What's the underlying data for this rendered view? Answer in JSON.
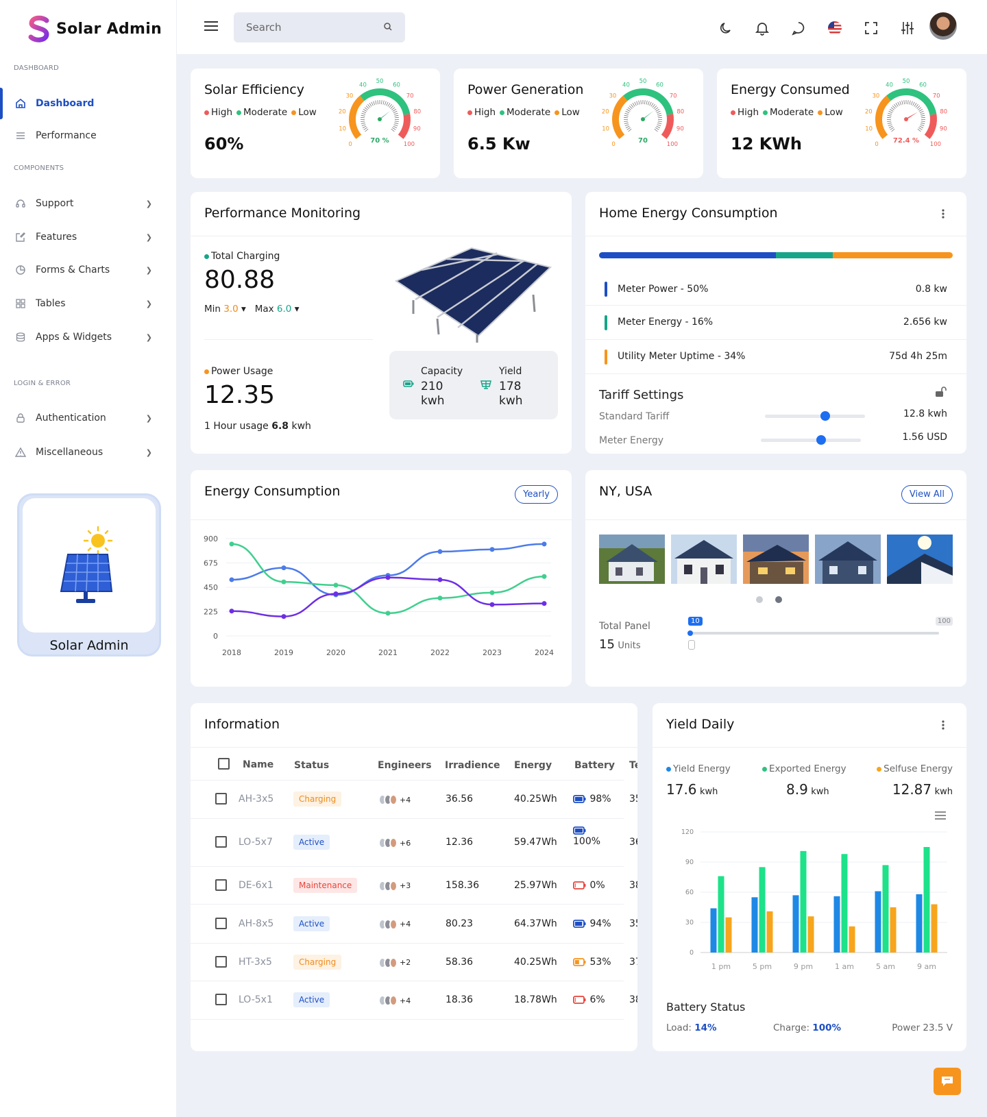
{
  "app": {
    "name": "Solar Admin"
  },
  "sidebar": {
    "sections": [
      "DASHBOARD",
      "COMPONENTS",
      "LOGIN & ERROR"
    ],
    "items": [
      {
        "label": "Dashboard",
        "icon": "home-icon"
      },
      {
        "label": "Performance",
        "icon": "lines-icon"
      },
      {
        "label": "Support",
        "icon": "headset-icon"
      },
      {
        "label": "Features",
        "icon": "edit-icon"
      },
      {
        "label": "Forms & Charts",
        "icon": "pie-icon"
      },
      {
        "label": "Tables",
        "icon": "grid-icon"
      },
      {
        "label": "Apps & Widgets",
        "icon": "database-icon"
      },
      {
        "label": "Authentication",
        "icon": "lock-icon"
      },
      {
        "label": "Miscellaneous",
        "icon": "warning-icon"
      }
    ],
    "promo_label": "Solar Admin"
  },
  "topbar": {
    "search_placeholder": "Search"
  },
  "stats": [
    {
      "title": "Solar Efficiency",
      "value": "60%",
      "gauge_label": "70 %",
      "gauge_value": 70,
      "needle_color": "#2ba866"
    },
    {
      "title": "Power Generation",
      "value": "6.5 Kw",
      "gauge_label": "70",
      "gauge_value": 70,
      "needle_color": "#2ba866"
    },
    {
      "title": "Energy Consumed",
      "value": "12 KWh",
      "gauge_label": "72.4 %",
      "gauge_value": 72.4,
      "needle_color": "#ef5b5b"
    }
  ],
  "gauge_ticks": [
    "0",
    "10",
    "20",
    "30",
    "40",
    "50",
    "60",
    "70",
    "80",
    "90",
    "100"
  ],
  "legend_levels": [
    "High",
    "Moderate",
    "Low"
  ],
  "colors": {
    "primary": "#1d4fc4",
    "green": "#2ec27e",
    "orange": "#f7941d",
    "red": "#ef5b5b",
    "teal": "#17a589",
    "purple": "#6d2ee6"
  },
  "performance": {
    "title": "Performance Monitoring",
    "charging_label": "Total Charging",
    "charging_value": "80.88",
    "min_label": "Min",
    "min_value": "3.0",
    "max_label": "Max",
    "max_value": "6.0",
    "usage_label": "Power Usage",
    "usage_value": "12.35",
    "hour_usage_prefix": "1 Hour usage",
    "hour_usage_value": "6.8",
    "hour_usage_unit": "kwh",
    "capacity_label": "Capacity",
    "capacity_value": "210",
    "capacity_unit": "kwh",
    "yield_label": "Yield",
    "yield_value": "178",
    "yield_unit": "kwh"
  },
  "home_energy": {
    "title": "Home Energy Consumption",
    "bar": [
      50,
      16,
      34
    ],
    "meters": [
      {
        "label": "Meter Power - 50%",
        "value": "0.8 kw",
        "color": "#1d4fc4"
      },
      {
        "label": "Meter Energy - 16%",
        "value": "2.656 kw",
        "color": "#17a589"
      },
      {
        "label": "Utility Meter Uptime - 34%",
        "value": "75d 4h 25m",
        "color": "#f7941d"
      }
    ],
    "tariff_title": "Tariff Settings",
    "tariffs": [
      {
        "label": "Standard Tariff",
        "value": "12.8 kwh",
        "level": 0.6
      },
      {
        "label": "Meter Energy",
        "value": "1.56 USD",
        "level": 0.6
      }
    ]
  },
  "energy_chart_card": {
    "title": "Energy Consumption",
    "button": "Yearly"
  },
  "chart_data": {
    "type": "line",
    "x": [
      "2018",
      "2019",
      "2020",
      "2021",
      "2022",
      "2023",
      "2024"
    ],
    "yticks": [
      "0",
      "225",
      "450",
      "675",
      "900"
    ],
    "ylim": [
      0,
      900
    ],
    "series": [
      {
        "color": "#4c7be8",
        "values": [
          520,
          630,
          380,
          560,
          780,
          800,
          850
        ]
      },
      {
        "color": "#3fcf8e",
        "values": [
          850,
          500,
          470,
          210,
          350,
          400,
          550
        ]
      },
      {
        "color": "#6d2ee6",
        "values": [
          230,
          180,
          390,
          540,
          520,
          290,
          300
        ]
      }
    ]
  },
  "location": {
    "title": "NY, USA",
    "button": "View All",
    "panel_label": "Total Panel",
    "panel_value": "15",
    "panel_unit": "Units",
    "slider_min": "10",
    "slider_max": "100",
    "slider_level": 0.0
  },
  "info": {
    "title": "Information",
    "columns": [
      "Name",
      "Status",
      "Engineers",
      "Irradience",
      "Energy",
      "Battery",
      "Te"
    ],
    "rows": [
      {
        "name": "AH-3x5",
        "status": "Charging",
        "eng": "+4",
        "irr": "36.56",
        "energy": "40.25Wh",
        "battery": "98%",
        "te": "35"
      },
      {
        "name": "LO-5x7",
        "status": "Active",
        "eng": "+6",
        "irr": "12.36",
        "energy": "59.47Wh",
        "battery": "100%",
        "te": "36"
      },
      {
        "name": "DE-6x1",
        "status": "Maintenance",
        "eng": "+3",
        "irr": "158.36",
        "energy": "25.97Wh",
        "battery": "0%",
        "te": "38"
      },
      {
        "name": "AH-8x5",
        "status": "Active",
        "eng": "+4",
        "irr": "80.23",
        "energy": "64.37Wh",
        "battery": "94%",
        "te": "35"
      },
      {
        "name": "HT-3x5",
        "status": "Charging",
        "eng": "+2",
        "irr": "58.36",
        "energy": "40.25Wh",
        "battery": "53%",
        "te": "37."
      },
      {
        "name": "LO-5x1",
        "status": "Active",
        "eng": "+4",
        "irr": "18.36",
        "energy": "18.78Wh",
        "battery": "6%",
        "te": "38"
      }
    ]
  },
  "yield": {
    "title": "Yield Daily",
    "stats": [
      {
        "label": "Yield Energy",
        "value": "17.6",
        "unit": "kwh",
        "color": "#1e88e5"
      },
      {
        "label": "Exported Energy",
        "value": "8.9",
        "unit": "kwh",
        "color": "#2ec27e"
      },
      {
        "label": "Selfuse Energy",
        "value": "12.87",
        "unit": "kwh",
        "color": "#f7a51d"
      }
    ],
    "battery_title": "Battery Status",
    "load_label": "Load:",
    "load_value": "14%",
    "charge_label": "Charge:",
    "charge_value": "100%",
    "power_text": "Power 23.5 V"
  },
  "yield_chart": {
    "type": "bar",
    "categories": [
      "1 pm",
      "5 pm",
      "9 pm",
      "1 am",
      "5 am",
      "9 am"
    ],
    "yticks": [
      "0",
      "30",
      "60",
      "90",
      "120"
    ],
    "ylim": [
      0,
      120
    ],
    "series": [
      {
        "color": "#1e88e5",
        "values": [
          44,
          55,
          57,
          56,
          61,
          58
        ]
      },
      {
        "color": "#1de28a",
        "values": [
          76,
          85,
          101,
          98,
          87,
          105
        ]
      },
      {
        "color": "#f7a51d",
        "values": [
          35,
          41,
          36,
          26,
          45,
          48
        ]
      }
    ]
  }
}
